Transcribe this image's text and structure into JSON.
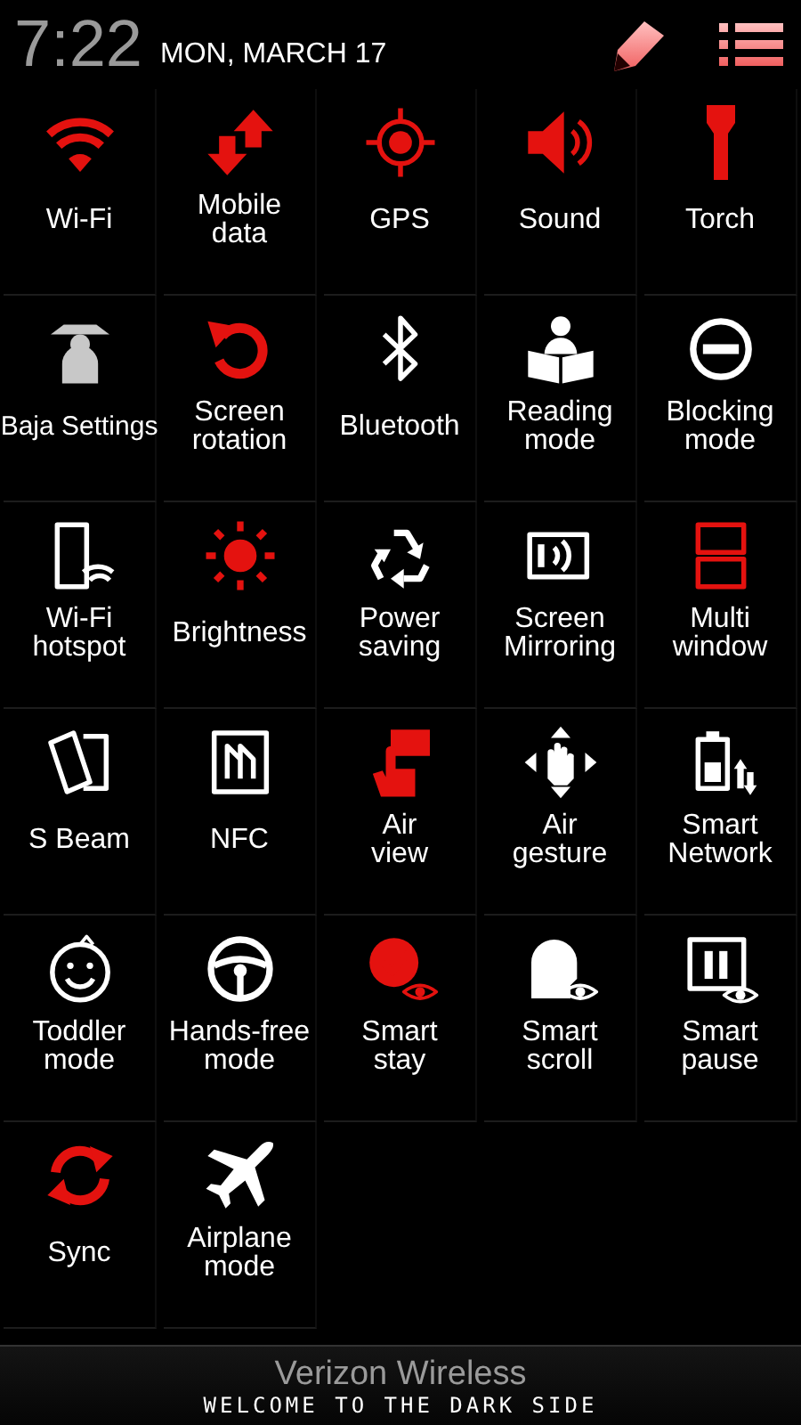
{
  "header": {
    "time": "7:22",
    "date": "MON, MARCH 17"
  },
  "tiles": [
    {
      "label": "Wi-Fi",
      "on": true
    },
    {
      "label": "Mobile data",
      "on": true
    },
    {
      "label": "GPS",
      "on": true
    },
    {
      "label": "Sound",
      "on": true
    },
    {
      "label": "Torch",
      "on": true
    },
    {
      "label": "Baja Settings",
      "on": false
    },
    {
      "label": "Screen rotation",
      "on": true
    },
    {
      "label": "Bluetooth",
      "on": false
    },
    {
      "label": "Reading mode",
      "on": false
    },
    {
      "label": "Blocking mode",
      "on": false
    },
    {
      "label": "Wi-Fi hotspot",
      "on": false
    },
    {
      "label": "Brightness",
      "on": true
    },
    {
      "label": "Power saving",
      "on": false
    },
    {
      "label": "Screen Mirroring",
      "on": false
    },
    {
      "label": "Multi window",
      "on": true
    },
    {
      "label": "S Beam",
      "on": false
    },
    {
      "label": "NFC",
      "on": false
    },
    {
      "label": "Air view",
      "on": true
    },
    {
      "label": "Air gesture",
      "on": false
    },
    {
      "label": "Smart Network",
      "on": false
    },
    {
      "label": "Toddler mode",
      "on": false
    },
    {
      "label": "Hands-free mode",
      "on": false
    },
    {
      "label": "Smart stay",
      "on": true
    },
    {
      "label": "Smart scroll",
      "on": false
    },
    {
      "label": "Smart pause",
      "on": false
    },
    {
      "label": "Sync",
      "on": true
    },
    {
      "label": "Airplane mode",
      "on": false
    }
  ],
  "footer": {
    "carrier": "Verizon Wireless",
    "slogan": "WELCOME TO THE DARK SIDE"
  }
}
